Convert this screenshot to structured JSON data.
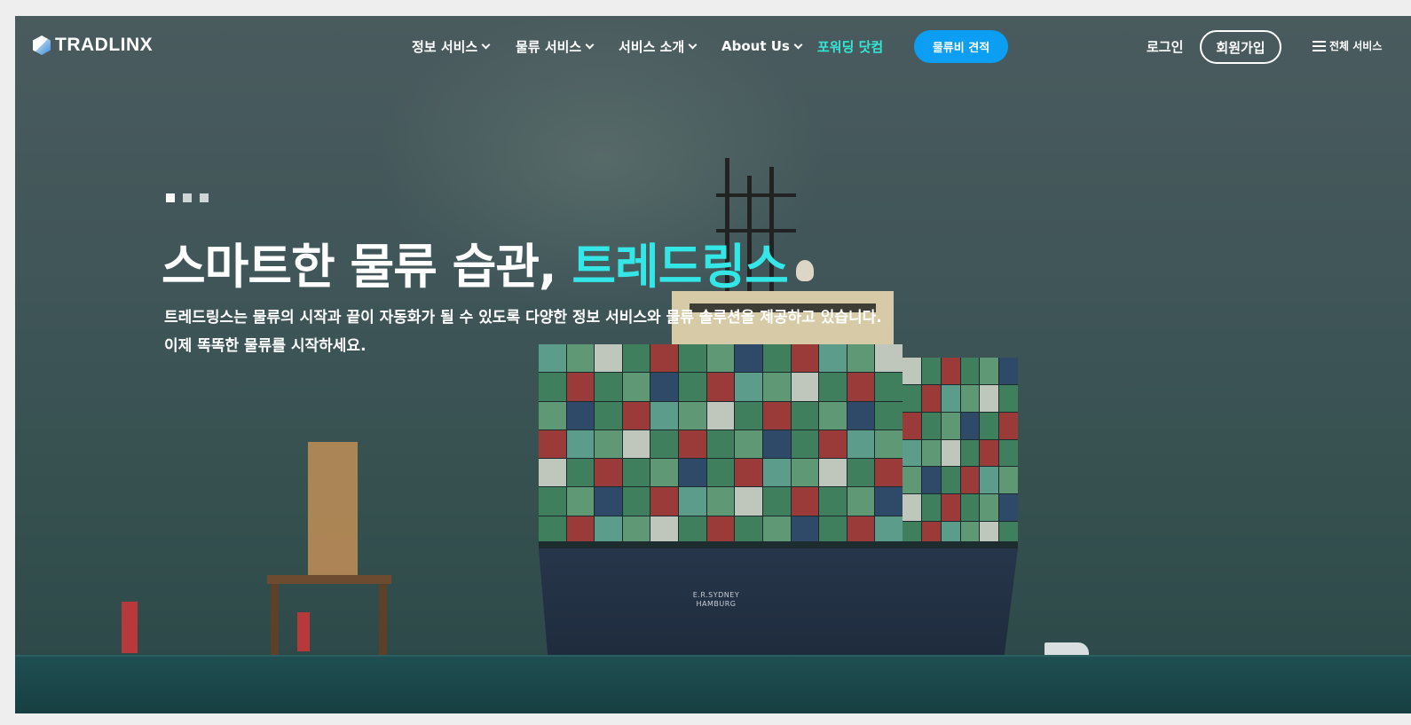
{
  "nav": {
    "logo_text": "TRADLINX",
    "menu": [
      {
        "label": "정보 서비스",
        "has_dropdown": true
      },
      {
        "label": "물류 서비스",
        "has_dropdown": true
      },
      {
        "label": "서비스 소개",
        "has_dropdown": true
      },
      {
        "label": "About Us",
        "has_dropdown": true
      },
      {
        "label": "포워딩 닷컴",
        "has_dropdown": false
      }
    ],
    "quote_button": "물류비 견적",
    "login": "로그인",
    "signup": "회원가입",
    "all_services": "전체 서비스"
  },
  "hero": {
    "title_main": "스마트한 물류 습관, ",
    "title_highlight": "트레드링스",
    "subtitle_line1": "트레드링스는 물류의 시작과 끝이 자동화가 될 수 있도록  다양한 정보 서비스와 물류 솔루션을 제공하고 있습니다.",
    "subtitle_line2": "이제 똑똑한 물류를 시작하세요.",
    "slide_indicators": 3,
    "active_slide": 1
  },
  "background": {
    "ship_name_line1": "E.R.SYDNEY",
    "ship_name_line2": "HAMBURG"
  },
  "colors": {
    "accent": "#34e6e6",
    "quote_button": "#0b9ef2",
    "nav_accent": "#34e6d6"
  }
}
